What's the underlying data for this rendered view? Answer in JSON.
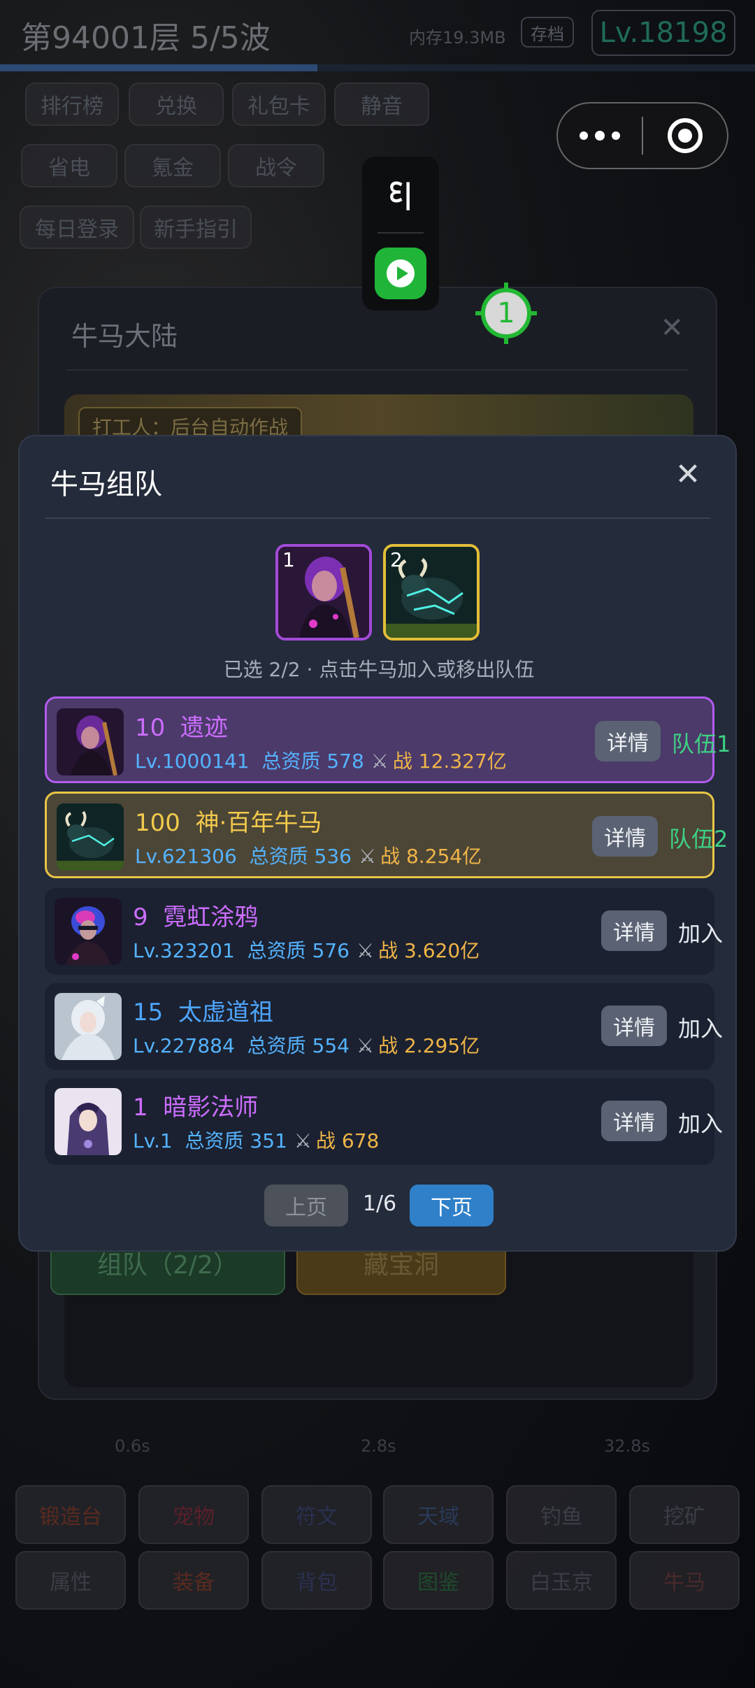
{
  "background": {
    "title": "第94001层  5/5波",
    "memory": "内存19.3MB",
    "save_label": "存档",
    "level": "Lv.18198",
    "wave_progress": 0.42,
    "top_buttons": [
      {
        "label": "排行榜",
        "color": "#5a4a20"
      },
      {
        "label": "兑换",
        "color": "#3a4048"
      },
      {
        "label": "礼包卡",
        "color": "#243a5a"
      },
      {
        "label": "静音",
        "color": "#5a2030"
      },
      {
        "label": "省电",
        "color": "#1d4a2c"
      },
      {
        "label": "氪金",
        "color": "#5a1f1f"
      },
      {
        "label": "战令",
        "color": "#5a3a1a"
      },
      {
        "label": "每日登录",
        "color": "#5a3e18"
      },
      {
        "label": "新手指引",
        "color": "#1d4a3a"
      }
    ],
    "map_window": {
      "title": "牛马大陆",
      "close": "✕",
      "banner_tag": "打工人：后台自动作战",
      "team_button": "组队（2/2）",
      "cave_button": "藏宝洞"
    },
    "times": [
      "0.6s",
      "2.8s",
      "32.8s"
    ],
    "bottom_nav_row1": [
      "锻造台",
      "宠物",
      "符文",
      "天域",
      "钓鱼",
      "挖矿"
    ],
    "bottom_nav_row2": [
      "属性",
      "装备",
      "背包",
      "图鉴",
      "白玉京",
      "牛马"
    ]
  },
  "floating": {
    "text_icon": "ᢄ|",
    "badge": "1"
  },
  "modal": {
    "title": "牛马组队",
    "close": "✕",
    "slots": [
      {
        "num": "1",
        "name": "遗迹",
        "icon": "punk-warrior-portrait"
      },
      {
        "num": "2",
        "name": "神·百年牛马",
        "icon": "glowing-bull-portrait"
      }
    ],
    "selected_info": "已选 2/2  ·  点击牛马加入或移出队伍",
    "rows": [
      {
        "rank": "10",
        "name": "遗迹",
        "level": "Lv.1000141",
        "quality": "总资质 578",
        "power": "战 12.327亿",
        "detail": "详情",
        "status": "队伍1",
        "name_color": "purple",
        "status_color": "green"
      },
      {
        "rank": "100",
        "name": "神·百年牛马",
        "level": "Lv.621306",
        "quality": "总资质 536",
        "power": "战 8.254亿",
        "detail": "详情",
        "status": "队伍2",
        "name_color": "gold",
        "status_color": "green"
      },
      {
        "rank": "9",
        "name": "霓虹涂鸦",
        "level": "Lv.323201",
        "quality": "总资质 576",
        "power": "战 3.620亿",
        "detail": "详情",
        "status": "加入",
        "name_color": "purple",
        "status_color": "white"
      },
      {
        "rank": "15",
        "name": "太虚道祖",
        "level": "Lv.227884",
        "quality": "总资质 554",
        "power": "战 2.295亿",
        "detail": "详情",
        "status": "加入",
        "name_color": "blue",
        "status_color": "white"
      },
      {
        "rank": "1",
        "name": "暗影法师",
        "level": "Lv.1",
        "quality": "总资质 351",
        "power": "战 678",
        "detail": "详情",
        "status": "加入",
        "name_color": "purple",
        "status_color": "white"
      }
    ],
    "pager": {
      "prev": "上页",
      "page": "1/6",
      "next": "下页"
    }
  }
}
